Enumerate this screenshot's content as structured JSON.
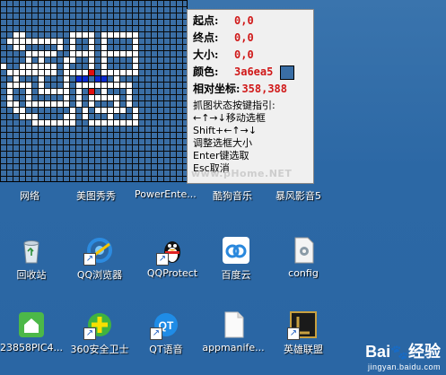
{
  "info_panel": {
    "start_label": "起点:",
    "start_value": "0,0",
    "end_label": "终点:",
    "end_value": "0,0",
    "size_label": "大小:",
    "size_value": "0,0",
    "color_label": "颜色:",
    "color_value": "3a6ea5",
    "relative_label": "相对坐标:",
    "relative_value": "358,388",
    "help": [
      "抓图状态按键指引:",
      "←↑→↓移动选框",
      "Shift+←↑→↓",
      "调整选框大小",
      "Enter键选取",
      "Esc取消"
    ]
  },
  "watermark": "www.pHome.NET",
  "top_row_labels": [
    "网络",
    "美图秀秀",
    "PowerEnte...",
    "酷狗音乐",
    "暴风影音5"
  ],
  "icons_row1": [
    {
      "label": "回收站",
      "icon": "recycle-bin-icon"
    },
    {
      "label": "QQ浏览器",
      "icon": "qq-browser-icon"
    },
    {
      "label": "QQProtect",
      "icon": "qq-penguin-icon"
    },
    {
      "label": "百度云",
      "icon": "baidu-cloud-icon"
    },
    {
      "label": "config",
      "icon": "config-file-icon"
    }
  ],
  "icons_row2": [
    {
      "label": "23858PIC4...",
      "icon": "house-app-icon"
    },
    {
      "label": "360安全卫士",
      "icon": "360-safe-icon"
    },
    {
      "label": "QT语音",
      "icon": "qt-voice-icon"
    },
    {
      "label": "appmanife...",
      "icon": "blank-file-icon"
    },
    {
      "label": "英雄联盟",
      "icon": "lol-icon"
    }
  ],
  "brand": {
    "text_a": "Bai",
    "paw": "🐾",
    "text_b": "经验",
    "sub": "jingyan.baidu.com"
  },
  "colors": {
    "sample": "#3a6ea5",
    "value_red": "#d01818"
  }
}
